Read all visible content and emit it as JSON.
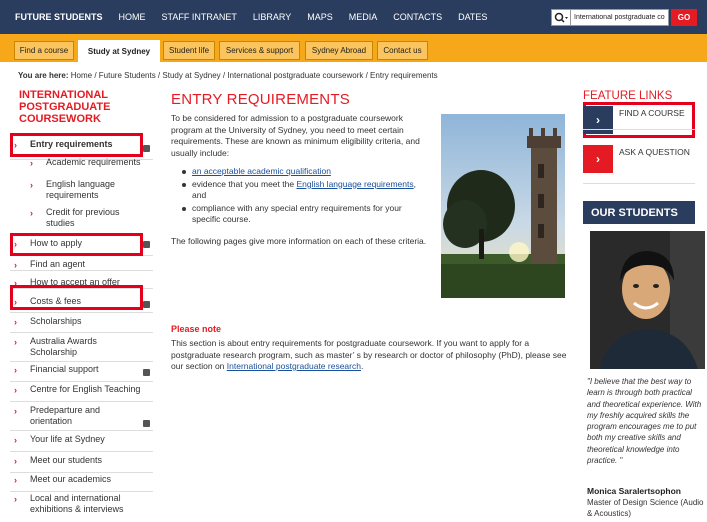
{
  "topnav": {
    "items": [
      "FUTURE STUDENTS",
      "HOME",
      "STAFF INTRANET",
      "LIBRARY",
      "MAPS",
      "MEDIA",
      "CONTACTS",
      "DATES"
    ]
  },
  "search": {
    "value": "International postgraduate co",
    "go_label": "GO",
    "icon": "search-icon"
  },
  "tabs": [
    "Find a course",
    "Study at Sydney",
    "Student life",
    "Services & support",
    "Sydney Abroad",
    "Contact us"
  ],
  "active_tab": "Study at Sydney",
  "breadcrumb": {
    "prefix": "You are here:",
    "path": "Home / Future Students / Study at Sydney / International postgraduate coursework / Entry requirements"
  },
  "sidebar": {
    "title": "INTERNATIONAL POSTGRADUATE COURSEWORK",
    "items": [
      {
        "label": "Entry requirements"
      },
      {
        "label": "Academic requirements"
      },
      {
        "label": "English language requirements"
      },
      {
        "label": "Credit for previous studies"
      },
      {
        "label": "How to apply"
      },
      {
        "label": "Find an agent"
      },
      {
        "label": "How to accept an offer"
      },
      {
        "label": "Costs & fees"
      },
      {
        "label": "Scholarships"
      },
      {
        "label": "Australia Awards Scholarship"
      },
      {
        "label": "Financial support"
      },
      {
        "label": "Centre for English Teaching"
      },
      {
        "label": "Predeparture and orientation"
      },
      {
        "label": "Your life at Sydney"
      },
      {
        "label": "Meet our students"
      },
      {
        "label": "Meet our academics"
      },
      {
        "label": "Local and international exhibitions & interviews"
      }
    ]
  },
  "main": {
    "title": "ENTRY REQUIREMENTS",
    "intro": "To be considered for admission to a postgraduate coursework program at the University of Sydney, you need to meet certain requirements. These are known as minimum eligibility criteria, and usually include:",
    "list": {
      "item1_link": "an acceptable academic qualification",
      "item2_text": "evidence that you meet the ",
      "item2_link": "English language requirements",
      "item2_tail": ", and",
      "item3_text": "compliance with any special entry requirements for your specific course."
    },
    "outro": "The following pages give more information on each of these criteria.",
    "note_title": "Please note",
    "note_text": "This section is about entry requirements for postgraduate coursework. If you want to apply for a postgraduate research program, such as master’ s by research or doctor of philosophy (PhD), please see our section on ",
    "note_link": "International postgraduate research",
    "note_end": "."
  },
  "feature": {
    "title": "FEATURE LINKS",
    "links": [
      {
        "label": "FIND A COURSE",
        "color": "#2b3d5e"
      },
      {
        "label": "ASK A QUESTION",
        "color": "#e41b23"
      }
    ]
  },
  "students": {
    "heading": "OUR STUDENTS",
    "quote": "\"I believe that the best way to learn is through both practical and theoretical experience. With my freshly acquired skills the program encourages me to put both my creative skills and theoretical knowledge into practice. \"",
    "name": "Monica Saralertsophon",
    "role": "Master of Design Science (Audio & Acoustics)"
  },
  "colors": {
    "nav": "#2b3d5e",
    "accent": "#e41b23",
    "tabbar": "#f7a71a",
    "highlight": "#e4001c"
  }
}
